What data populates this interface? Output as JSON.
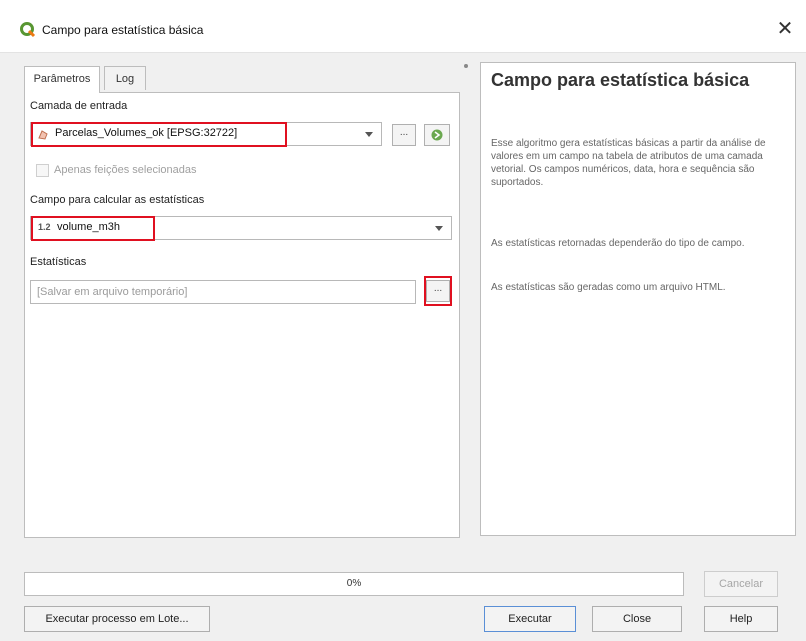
{
  "window": {
    "title": "Campo para estatística básica",
    "icon": "qgis-logo-icon",
    "accent": "#5a8fd6",
    "highlight_color": "#e01020"
  },
  "tabs": [
    {
      "label": "Parâmetros",
      "active": true
    },
    {
      "label": "Log",
      "active": false
    }
  ],
  "params": {
    "input_layer_label": "Camada de entrada",
    "input_layer_value": "Parcelas_Volumes_ok [EPSG:32722]",
    "selected_only_label": "Apenas feições selecionadas",
    "field_label": "Campo para calcular as estatísticas",
    "field_type": "1.2",
    "field_value": "volume_m3h",
    "stats_label": "Estatísticas",
    "stats_placeholder": "[Salvar em arquivo temporário]",
    "browse": "..."
  },
  "help": {
    "title": "Campo para estatística básica",
    "paragraphs": [
      "Esse algoritmo gera estatísticas básicas a partir da análise de valores em um campo na tabela de atributos de uma camada vetorial. Os campos numéricos, data, hora e sequência são suportados.",
      "As estatísticas retornadas dependerão do tipo de campo.",
      "As estatísticas são geradas como um arquivo HTML."
    ]
  },
  "progress": {
    "text": "0%",
    "value": 0
  },
  "buttons": {
    "cancel": "Cancelar",
    "batch": "Executar processo em Lote...",
    "run": "Executar",
    "close": "Close",
    "help": "Help"
  }
}
